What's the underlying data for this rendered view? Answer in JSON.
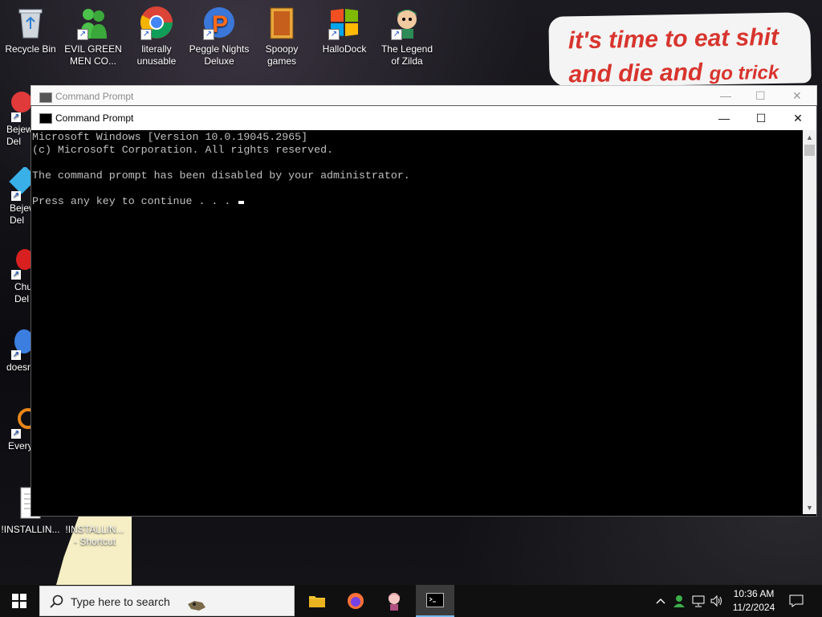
{
  "desktop": {
    "meme_line1": "it's time to eat shit",
    "meme_line2a": "and die and ",
    "meme_line2b": "go trick",
    "icons_top": [
      {
        "name": "recycle-bin-icon",
        "label": "Recycle Bin"
      },
      {
        "name": "evil-green-men-icon",
        "label": "EVIL GREEN MEN CO..."
      },
      {
        "name": "chrome-icon",
        "label": "literally unusable"
      },
      {
        "name": "peggle-icon",
        "label": "Peggle Nights Deluxe"
      },
      {
        "name": "spoopy-games-icon",
        "label": "Spoopy games"
      },
      {
        "name": "hallodock-icon",
        "label": "HalloDock"
      },
      {
        "name": "zelda-icon",
        "label": "The Legend of Zilda"
      }
    ],
    "icons_left": [
      {
        "label": "Bejew Del"
      },
      {
        "label": "Bejew Del"
      },
      {
        "label": "Chu Del"
      },
      {
        "label": "doesn"
      },
      {
        "label": "Every"
      }
    ],
    "icons_bottom": [
      {
        "label": "!INSTALLIN..."
      },
      {
        "label": "!INSTALLIN... - Shortcut"
      }
    ]
  },
  "cmd_back": {
    "title": "Command Prompt"
  },
  "cmd": {
    "title": "Command Prompt",
    "lines": [
      "Microsoft Windows [Version 10.0.19045.2965]",
      "(c) Microsoft Corporation. All rights reserved.",
      "",
      "The command prompt has been disabled by your administrator.",
      "",
      "Press any key to continue . . . "
    ]
  },
  "taskbar": {
    "search_placeholder": "Type here to search",
    "time": "10:36 AM",
    "date": "11/2/2024"
  },
  "colors": {
    "meme_text": "#d8342e",
    "console_text": "#c0c0c0",
    "accent": "#76b9ed"
  }
}
